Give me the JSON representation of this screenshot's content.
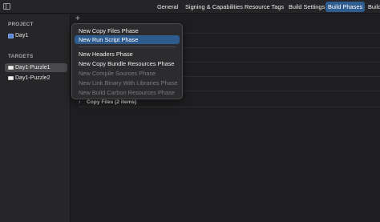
{
  "tabs": [
    "General",
    "Signing & Capabilities",
    "Resource Tags",
    "Build Settings",
    "Build Phases",
    "Build"
  ],
  "active_tab": "Build Phases",
  "sidebar": {
    "project_header": "PROJECT",
    "project_item": "Day1",
    "targets_header": "TARGETS",
    "targets": [
      "Day1-Puzzle1",
      "Day1-Puzzle2"
    ]
  },
  "main": {
    "add_button": "+",
    "phase_row_label": "Copy Files (2 items)"
  },
  "menu": {
    "items": [
      {
        "label": "New Copy Files Phase",
        "state": "enabled"
      },
      {
        "label": "New Run Script Phase",
        "state": "highlighted"
      },
      {
        "label": "New Headers Phase",
        "state": "enabled"
      },
      {
        "label": "New Copy Bundle Resources Phase",
        "state": "enabled"
      },
      {
        "label": "New Compile Sources Phase",
        "state": "disabled"
      },
      {
        "label": "New Link Binary With Libraries Phase",
        "state": "disabled"
      },
      {
        "label": "New Build Carbon Resources Phase",
        "state": "disabled"
      }
    ]
  },
  "colors": {
    "accent": "#2e5c8e",
    "background": "#1e1e20",
    "sidebar": "#262628"
  }
}
